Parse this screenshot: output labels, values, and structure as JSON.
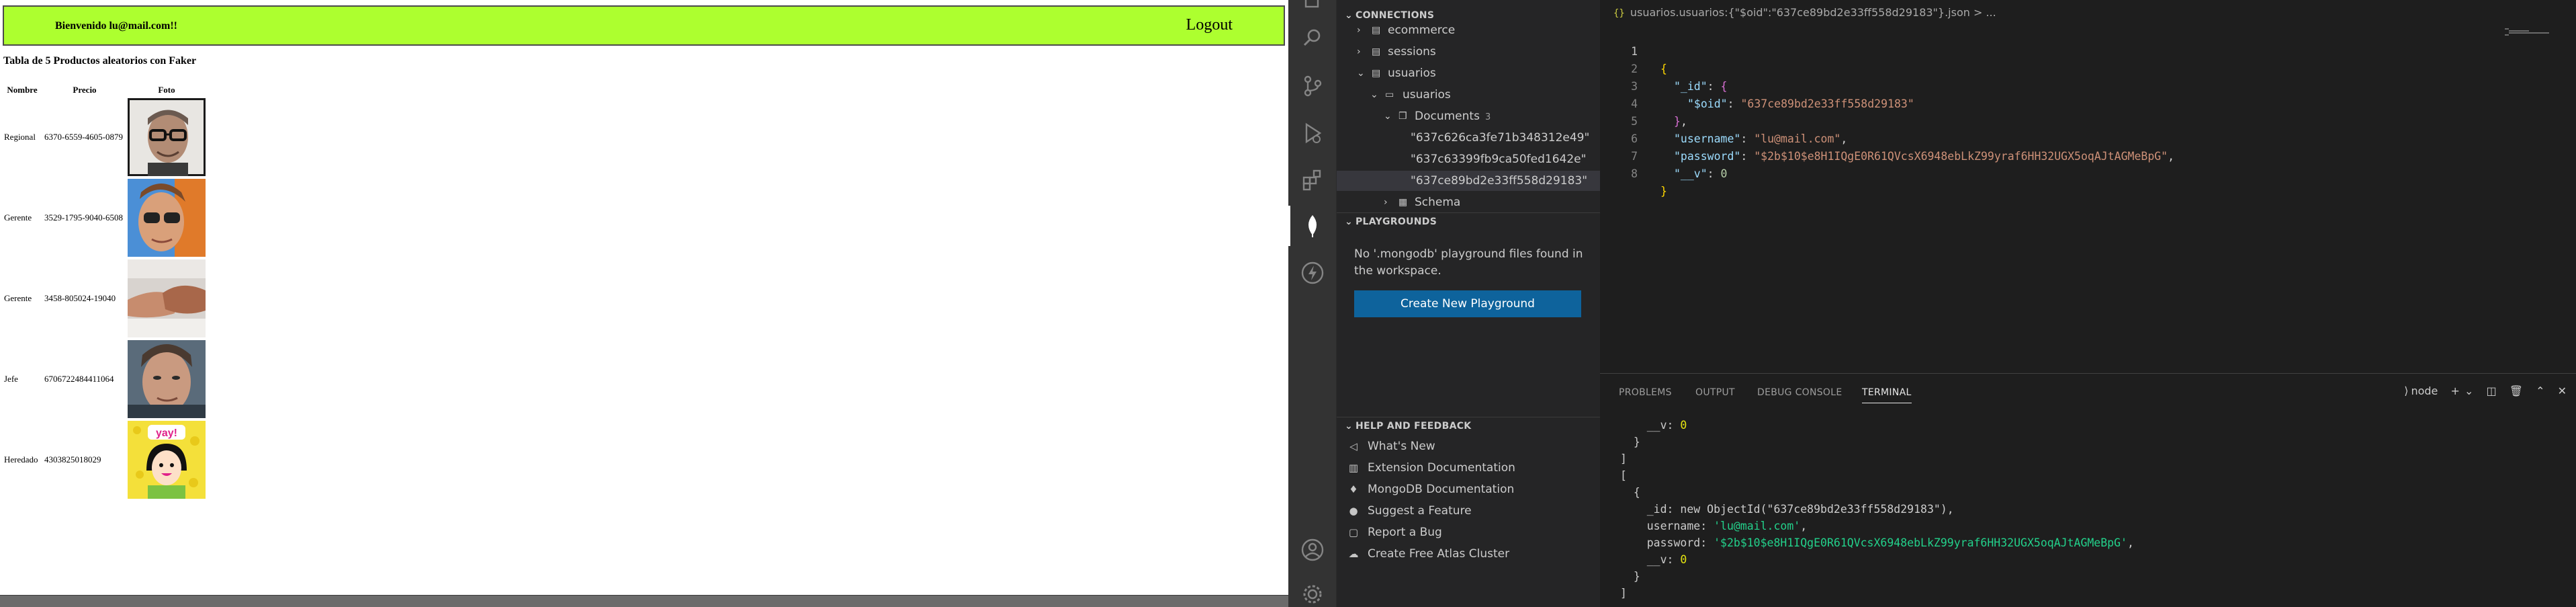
{
  "browser": {
    "welcome": "Bienvenido lu@mail.com!!",
    "logout": "Logout",
    "table_title": "Tabla de 5 Productos aleatorios con Faker",
    "columns": [
      "Nombre",
      "Precio",
      "Foto"
    ],
    "rows": [
      {
        "name": "Regional",
        "price": "6370-6559-4605-0879",
        "photo": "man-glasses-photo"
      },
      {
        "name": "Gerente",
        "price": "3529-1795-9040-6508",
        "photo": "man-sunglasses-photo"
      },
      {
        "name": "Gerente",
        "price": "3458-805024-19040",
        "photo": "hands-photo"
      },
      {
        "name": "Jefe",
        "price": "6706722484411064",
        "photo": "man-portrait-photo"
      },
      {
        "name": "Heredado",
        "price": "4303825018029",
        "photo": "yay-cartoon-photo"
      }
    ],
    "photo_yay_text": "yay!"
  },
  "vscode": {
    "sidebar": {
      "connections_header": "CONNECTIONS",
      "tree": [
        {
          "label": "ecommerce",
          "count": ""
        },
        {
          "label": "sessions",
          "count": ""
        },
        {
          "label": "usuarios",
          "count": ""
        },
        {
          "label": "usuarios",
          "count": ""
        },
        {
          "label": "Documents",
          "count": "3"
        },
        {
          "label": "\"637c626ca3fe71b348312e49\"",
          "count": ""
        },
        {
          "label": "\"637c63399fb9ca50fed1642e\"",
          "count": ""
        },
        {
          "label": "\"637ce89bd2e33ff558d29183\"",
          "count": ""
        },
        {
          "label": "Schema",
          "count": ""
        }
      ],
      "playgrounds_header": "PLAYGROUNDS",
      "playground_message": "No '.mongodb' playground files found in the workspace.",
      "create_playground": "Create New Playground",
      "help_header": "HELP AND FEEDBACK",
      "help_items": [
        {
          "label": "What's New",
          "icon": "megaphone-icon"
        },
        {
          "label": "Extension Documentation",
          "icon": "book-icon"
        },
        {
          "label": "MongoDB Documentation",
          "icon": "leaf-icon"
        },
        {
          "label": "Suggest a Feature",
          "icon": "lightbulb-icon"
        },
        {
          "label": "Report a Bug",
          "icon": "report-icon"
        },
        {
          "label": "Create Free Atlas Cluster",
          "icon": "cloud-icon"
        }
      ]
    },
    "editor": {
      "breadcrumb_icon": "{}",
      "breadcrumb": "usuarios.usuarios:{\"$oid\":\"637ce89bd2e33ff558d29183\"}.json > ...",
      "line_numbers": [
        "1",
        "2",
        "3",
        "4",
        "5",
        "6",
        "7",
        "8"
      ],
      "lines": {
        "l1": "{",
        "l2_key": "\"_id\"",
        "l2_rest": ": ",
        "l2_brace": "{",
        "l3_key": "\"$oid\"",
        "l3_sep": ": ",
        "l3_val": "\"637ce89bd2e33ff558d29183\"",
        "l4_brace": "}",
        "l4_rest": ",",
        "l5_key": "\"username\"",
        "l5_sep": ": ",
        "l5_val": "\"lu@mail.com\"",
        "l5_end": ",",
        "l6_key": "\"password\"",
        "l6_sep": ": ",
        "l6_val": "\"$2b$10$e8H1IQgE0R61QVcsX6948ebLkZ99yraf6HH32UGX5oqAJtAGMeBpG\"",
        "l6_end": ",",
        "l7_key": "\"__v\"",
        "l7_sep": ": ",
        "l7_val": "0",
        "l8": "}"
      }
    },
    "panel": {
      "tabs": [
        "PROBLEMS",
        "OUTPUT",
        "DEBUG CONSOLE",
        "TERMINAL"
      ],
      "active_tab": "TERMINAL",
      "terminal_name": "node",
      "terminal": {
        "t1_pre": "    __v: ",
        "t1_num": "0",
        "t2": "  }",
        "t3": "]",
        "t4": "[",
        "t5": "  {",
        "t6": "    _id: new ObjectId(\"637ce89bd2e33ff558d29183\"),",
        "t7_pre": "    username: ",
        "t7_str": "'lu@mail.com'",
        "t7_end": ",",
        "t8_pre": "    password: ",
        "t8_str": "'$2b$10$e8H1IQgE0R61QVcsX6948ebLkZ99yraf6HH32UGX5oqAJtAGMeBpG'",
        "t8_end": ",",
        "t9_pre": "    __v: ",
        "t9_num": "0",
        "t10": "  }",
        "t11": "]"
      }
    }
  }
}
